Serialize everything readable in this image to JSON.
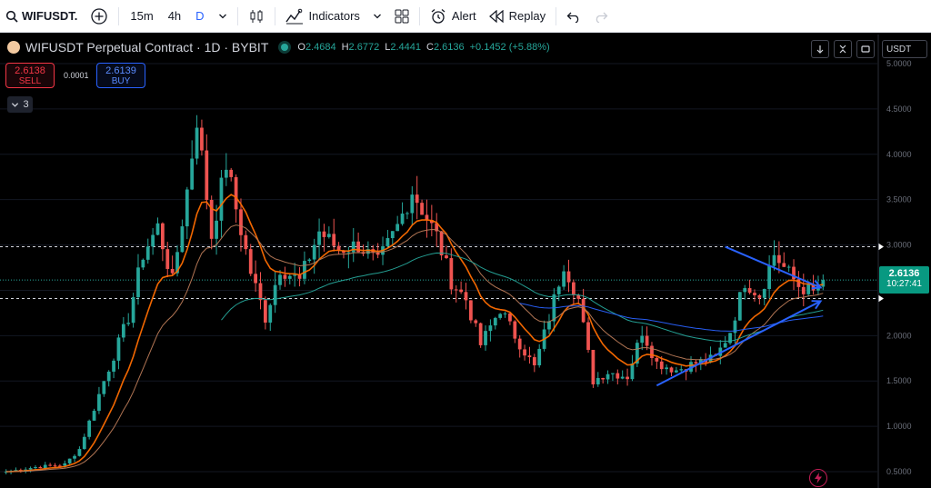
{
  "toolbar": {
    "symbol": "WIFUSDT.",
    "intervals": [
      "15m",
      "4h",
      "D"
    ],
    "active_interval": "D",
    "indicators_label": "Indicators",
    "alert_label": "Alert",
    "replay_label": "Replay"
  },
  "legend": {
    "title": "WIFUSDT Perpetual Contract · 1D · BYBIT",
    "o_label": "O",
    "o": "2.4684",
    "h_label": "H",
    "h": "2.6772",
    "l_label": "L",
    "l": "2.4441",
    "c_label": "C",
    "c": "2.6136",
    "change": "+0.1452 (+5.88%)"
  },
  "trade": {
    "sell_price": "2.6138",
    "sell_label": "SELL",
    "buy_price": "2.6139",
    "buy_label": "BUY",
    "spread": "0.0001"
  },
  "collapse_count": "3",
  "currency": "USDT",
  "last_price": {
    "price": "2.6136",
    "countdown": "10:27:41"
  },
  "colors": {
    "up": "#26a69a",
    "down": "#ef5350",
    "ema_fast": "#ff6d00",
    "ema_mid": "#b97a57",
    "ema_slow": "#26a69a",
    "ema_long": "#2962ff",
    "drawing": "#2962ff"
  },
  "chart_data": {
    "type": "candlestick",
    "y_axis": {
      "ylim": [
        0.39,
        5.0
      ],
      "ticks": [
        "5.0000",
        "4.5000",
        "4.0000",
        "3.5000",
        "3.0000",
        "2.5000",
        "2.0000",
        "1.5000",
        "1.0000",
        "0.5000"
      ]
    },
    "horizontal_levels": [
      2.98,
      2.41
    ],
    "last_close": 2.6136,
    "segments": [
      [
        0,
        0.5
      ],
      [
        6,
        0.55
      ],
      [
        12,
        0.58
      ],
      [
        15,
        0.75
      ],
      [
        20,
        1.5
      ],
      [
        25,
        2.2
      ],
      [
        28,
        2.9
      ],
      [
        31,
        3.2
      ],
      [
        34,
        2.6
      ],
      [
        37,
        3.6
      ],
      [
        39,
        4.4
      ],
      [
        42,
        3.1
      ],
      [
        45,
        3.9
      ],
      [
        47,
        3.4
      ],
      [
        50,
        2.7
      ],
      [
        53,
        2.2
      ],
      [
        56,
        2.75
      ],
      [
        60,
        2.6
      ],
      [
        64,
        3.15
      ],
      [
        68,
        2.95
      ],
      [
        72,
        3.0
      ],
      [
        76,
        2.8
      ],
      [
        80,
        3.2
      ],
      [
        83,
        3.6
      ],
      [
        86,
        3.3
      ],
      [
        88,
        3.1
      ],
      [
        91,
        2.6
      ],
      [
        94,
        2.4
      ],
      [
        97,
        1.9
      ],
      [
        101,
        2.3
      ],
      [
        104,
        2.0
      ],
      [
        108,
        1.65
      ],
      [
        111,
        2.2
      ],
      [
        114,
        2.8
      ],
      [
        117,
        2.4
      ],
      [
        120,
        1.5
      ],
      [
        123,
        1.6
      ],
      [
        127,
        1.55
      ],
      [
        130,
        2.05
      ],
      [
        133,
        1.7
      ],
      [
        137,
        1.62
      ],
      [
        141,
        1.7
      ],
      [
        145,
        1.75
      ],
      [
        148,
        2.05
      ],
      [
        151,
        2.6
      ],
      [
        154,
        2.45
      ],
      [
        157,
        2.9
      ],
      [
        159,
        2.75
      ],
      [
        162,
        2.55
      ],
      [
        165,
        2.47
      ],
      [
        167,
        2.61
      ]
    ],
    "ema_periods": [
      10,
      20,
      50,
      100
    ],
    "annotations": {
      "upper_trendline": [
        [
          147,
          2.98
        ],
        [
          165,
          2.53
        ]
      ],
      "lower_trendline": [
        [
          133,
          1.45
        ],
        [
          165,
          2.38
        ]
      ],
      "slow_ema_visible_from_index": 44,
      "long_ema_visible_from_index": 105
    }
  }
}
